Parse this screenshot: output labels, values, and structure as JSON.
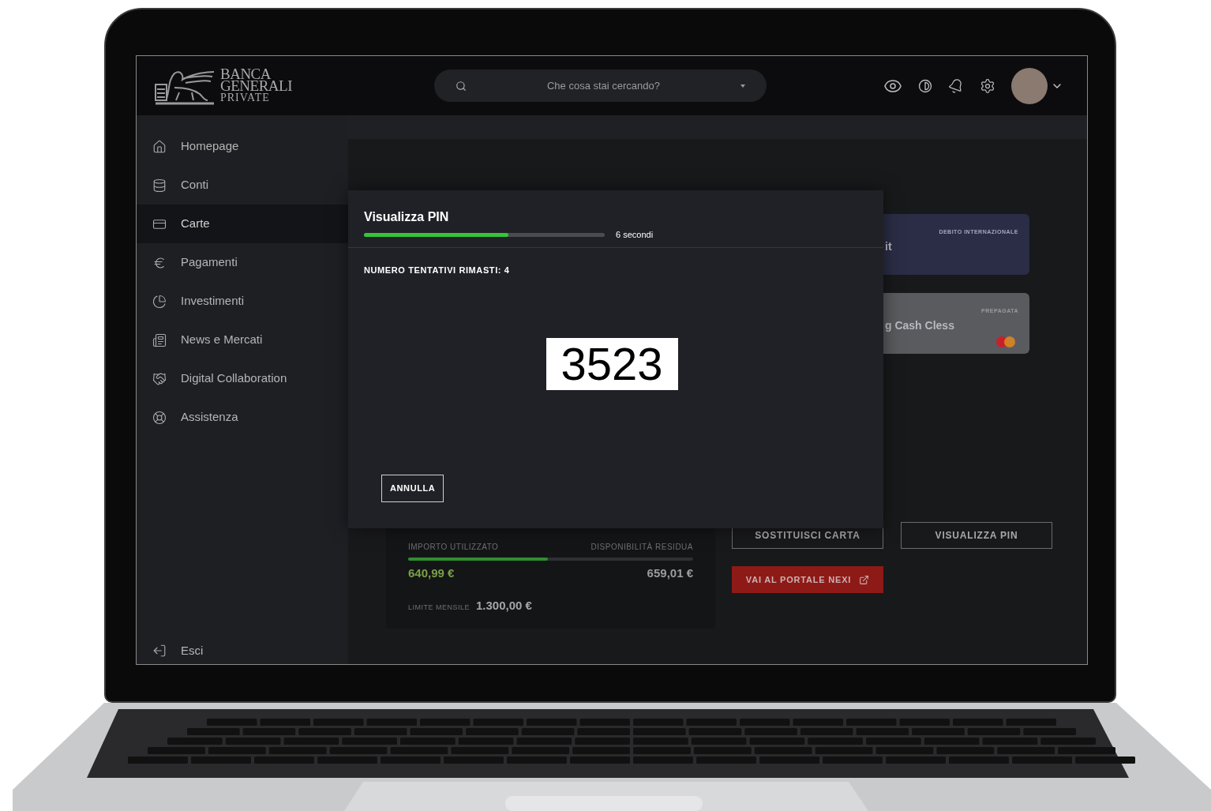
{
  "header": {
    "brand": [
      "BANCA",
      "GENERALI",
      "PRIVATE"
    ],
    "search": {
      "placeholder": "Che cosa stai cercando?"
    }
  },
  "sidebar": {
    "items": [
      {
        "label": "Homepage",
        "selected": false
      },
      {
        "label": "Conti",
        "selected": false
      },
      {
        "label": "Carte",
        "selected": true
      },
      {
        "label": "Pagamenti",
        "selected": false
      },
      {
        "label": "Investimenti",
        "selected": false
      },
      {
        "label": "News e Mercati",
        "selected": false
      },
      {
        "label": "Digital Collaboration",
        "selected": false
      },
      {
        "label": "Assistenza",
        "selected": false
      }
    ],
    "footer_item": {
      "label": "Esci"
    }
  },
  "cards": [
    {
      "kind": "debit",
      "type": "DEBITO INTERNAZIONALE",
      "name": "it"
    },
    {
      "kind": "prepaid",
      "type": "PREPAGATA",
      "name": "g Cash Cless"
    }
  ],
  "usage": {
    "used_label": "IMPORTO UTILIZZATO",
    "available_label": "DISPONIBILITÀ RESIDUA",
    "level": 0.49,
    "used": "640,99 €",
    "available": "659,01 €",
    "limit_label": "LIMITE MENSILE",
    "limit": "1.300,00 €"
  },
  "actions": [
    {
      "kind": "outline",
      "label": "SOSTITUISCI CARTA"
    },
    {
      "kind": "outline",
      "label": "VISUALIZZA PIN"
    },
    {
      "kind": "external",
      "label": "VAI AL PORTALE NEXI"
    }
  ],
  "modal": {
    "title": "Visualizza PIN",
    "timer": {
      "level": 0.6,
      "reading": "6 secondi"
    },
    "attempts": "NUMERO TENTATIVI RIMASTI: 4",
    "pin": "3523",
    "buttons": [
      "ANNULLA"
    ]
  }
}
